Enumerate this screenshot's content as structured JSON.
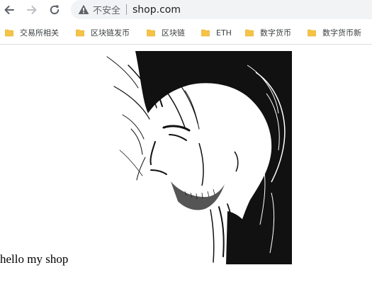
{
  "browser": {
    "security_label": "不安全",
    "url": "shop.com"
  },
  "bookmarks": [
    {
      "label": "交易所相关"
    },
    {
      "label": "区块链发币"
    },
    {
      "label": "区块链"
    },
    {
      "label": "ETH"
    },
    {
      "label": "数字货币"
    },
    {
      "label": "数字货币新"
    }
  ],
  "page": {
    "body_text": "hello my shop",
    "image_subject": "ink illustration of a long-haired samurai looking down"
  },
  "icons": {
    "back": "back-arrow-icon",
    "forward": "forward-arrow-icon",
    "reload": "reload-icon",
    "security": "warning-triangle-icon",
    "folder": "folder-icon"
  },
  "colors": {
    "folder": "#f6c344",
    "omnibox_bg": "#f1f3f4",
    "text": "#202124"
  }
}
